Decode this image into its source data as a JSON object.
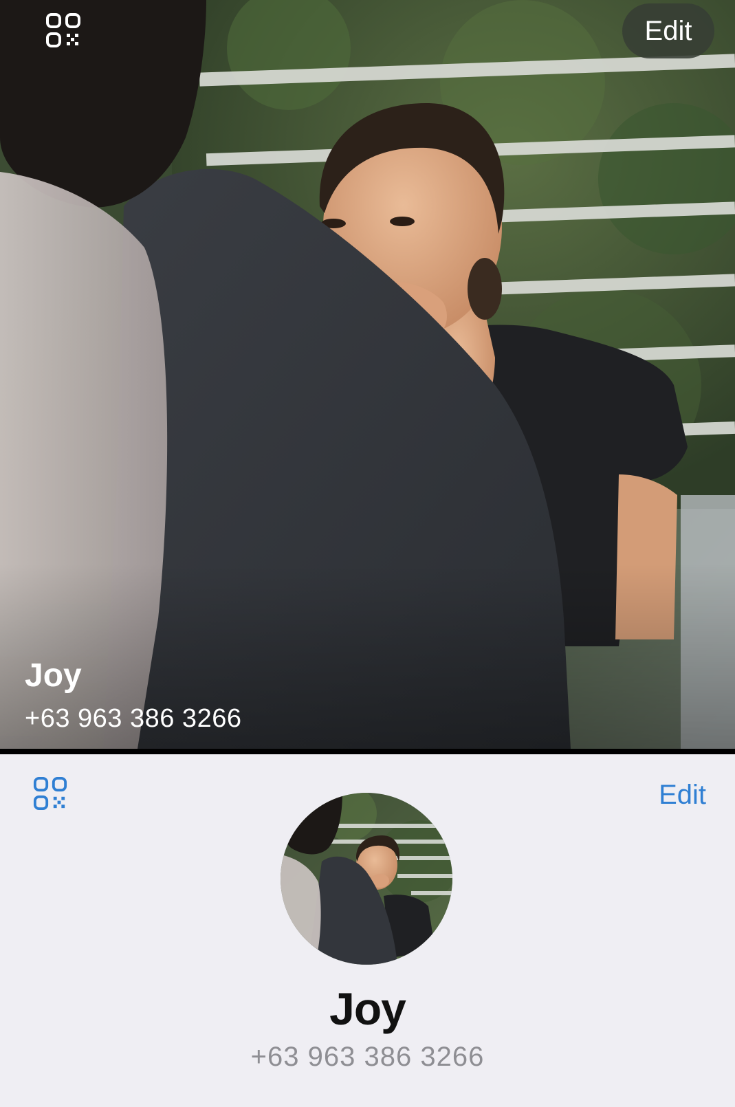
{
  "hero_view": {
    "qr_icon": "qr-code-icon",
    "edit_label": "Edit",
    "contact_name": "Joy",
    "phone_number": "+63 963 386 3266"
  },
  "compact_view": {
    "qr_icon": "qr-code-icon",
    "edit_label": "Edit",
    "contact_name": "Joy",
    "phone_number": "+63 963 386 3266"
  },
  "colors": {
    "accent_blue": "#2f7fd3",
    "secondary_text": "#8e8e93",
    "background": "#efeef3"
  }
}
